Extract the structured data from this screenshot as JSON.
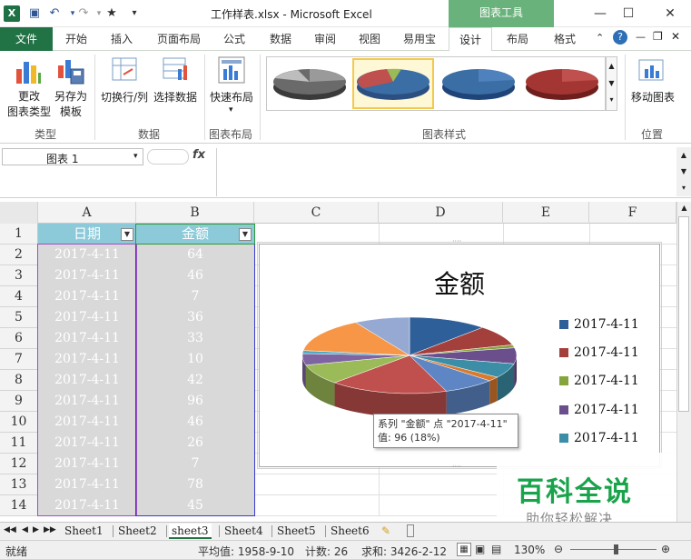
{
  "window": {
    "title": "工作样表.xlsx  -  Microsoft Excel",
    "app_icon": "X",
    "context_tab_group": "图表工具"
  },
  "tabs": [
    {
      "label": "文件"
    },
    {
      "label": "开始"
    },
    {
      "label": "插入"
    },
    {
      "label": "页面布局"
    },
    {
      "label": "公式"
    },
    {
      "label": "数据"
    },
    {
      "label": "审阅"
    },
    {
      "label": "视图"
    },
    {
      "label": "易用宝"
    },
    {
      "label": "设计"
    },
    {
      "label": "布局"
    },
    {
      "label": "格式"
    }
  ],
  "ribbon": {
    "change_type": {
      "line1": "更改",
      "line2": "图表类型"
    },
    "save_template": {
      "line1": "另存为",
      "line2": "模板"
    },
    "switch_rowcol": "切换行/列",
    "select_data": "选择数据",
    "quick_layout": "快速布局",
    "move_chart": "移动图表",
    "groups": {
      "type": "类型",
      "data": "数据",
      "layout": "图表布局",
      "styles": "图表样式",
      "location": "位置"
    }
  },
  "formula_bar": {
    "name_box": "图表 1",
    "fx": "fx",
    "value": ""
  },
  "columns": [
    "A",
    "B",
    "C",
    "D",
    "E",
    "F"
  ],
  "rows": [
    "1",
    "2",
    "3",
    "4",
    "5",
    "6",
    "7",
    "8",
    "9",
    "10",
    "11",
    "12",
    "13",
    "14"
  ],
  "table": {
    "headers": [
      "日期",
      "金额"
    ],
    "data": [
      [
        "2017-4-11",
        "64"
      ],
      [
        "2017-4-11",
        "46"
      ],
      [
        "2017-4-11",
        "7"
      ],
      [
        "2017-4-11",
        "36"
      ],
      [
        "2017-4-11",
        "33"
      ],
      [
        "2017-4-11",
        "10"
      ],
      [
        "2017-4-11",
        "42"
      ],
      [
        "2017-4-11",
        "96"
      ],
      [
        "2017-4-11",
        "46"
      ],
      [
        "2017-4-11",
        "26"
      ],
      [
        "2017-4-11",
        "7"
      ],
      [
        "2017-4-11",
        "78"
      ],
      [
        "2017-4-11",
        "45"
      ]
    ]
  },
  "chart_data": {
    "type": "pie",
    "title": "金额",
    "categories": [
      "2017-4-11",
      "2017-4-11",
      "2017-4-11",
      "2017-4-11",
      "2017-4-11",
      "2017-4-11",
      "2017-4-11",
      "2017-4-11",
      "2017-4-11",
      "2017-4-11",
      "2017-4-11",
      "2017-4-11",
      "2017-4-11"
    ],
    "values": [
      64,
      46,
      7,
      36,
      33,
      10,
      42,
      96,
      46,
      26,
      7,
      78,
      45
    ],
    "colors": [
      "#2f5f98",
      "#a4403c",
      "#86a43c",
      "#6a4f8c",
      "#3b8ea6",
      "#d97a2e",
      "#5e86c5",
      "#c0504d",
      "#9bbb59",
      "#7f64a2",
      "#4bacc6",
      "#f79646",
      "#95a9d3"
    ],
    "legend": [
      "2017-4-11",
      "2017-4-11",
      "2017-4-11",
      "2017-4-11",
      "2017-4-11"
    ],
    "legend_placement": "right"
  },
  "tooltip": {
    "line1": "系列 \"金额\" 点 \"2017-4-11\"",
    "line2": "值: 96  (18%)"
  },
  "watermark": {
    "big": "百科全说",
    "small": "助你轻松解决"
  },
  "sheets": [
    "Sheet1",
    "Sheet2",
    "sheet3",
    "Sheet4",
    "Sheet5",
    "Sheet6"
  ],
  "active_sheet": "sheet3",
  "status": {
    "ready": "就绪",
    "average": "平均值: 1958-9-10",
    "count": "计数: 26",
    "sum": "求和: 3426-2-12",
    "zoom": "130%"
  }
}
